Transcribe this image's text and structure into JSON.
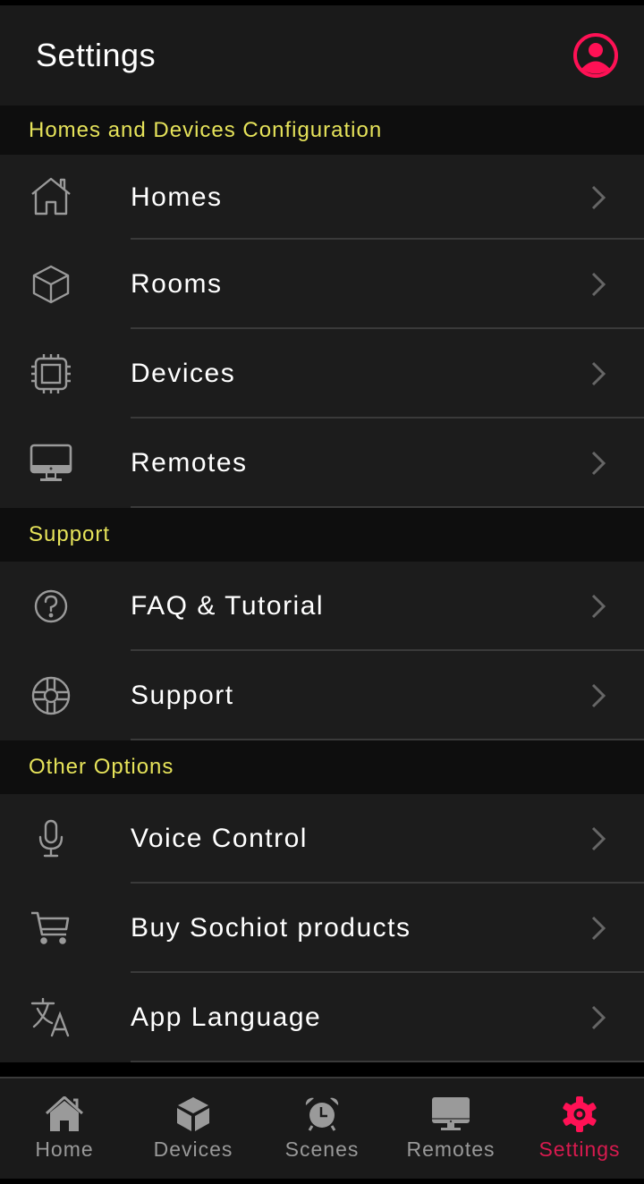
{
  "header": {
    "title": "Settings",
    "profile_icon": "account-circle-icon"
  },
  "colors": {
    "accent": "#ff1155",
    "section_text": "#e6e35a",
    "icon_gray": "#9a9a9a"
  },
  "sections": [
    {
      "title": "Homes and Devices Configuration",
      "items": [
        {
          "label": "Homes",
          "icon": "house-icon"
        },
        {
          "label": "Rooms",
          "icon": "cube-icon"
        },
        {
          "label": "Devices",
          "icon": "chip-icon"
        },
        {
          "label": "Remotes",
          "icon": "monitor-icon"
        }
      ]
    },
    {
      "title": "Support",
      "items": [
        {
          "label": "FAQ & Tutorial",
          "icon": "question-circle-icon"
        },
        {
          "label": "Support",
          "icon": "lifebuoy-icon"
        }
      ]
    },
    {
      "title": "Other Options",
      "items": [
        {
          "label": "Voice Control",
          "icon": "microphone-icon"
        },
        {
          "label": "Buy Sochiot products",
          "icon": "cart-icon"
        },
        {
          "label": "App Language",
          "icon": "translate-icon"
        }
      ]
    }
  ],
  "tabs": [
    {
      "label": "Home",
      "icon": "home-icon",
      "active": false
    },
    {
      "label": "Devices",
      "icon": "cube-icon",
      "active": false
    },
    {
      "label": "Scenes",
      "icon": "alarm-clock-icon",
      "active": false
    },
    {
      "label": "Remotes",
      "icon": "monitor-icon",
      "active": false
    },
    {
      "label": "Settings",
      "icon": "gear-icon",
      "active": true
    }
  ]
}
